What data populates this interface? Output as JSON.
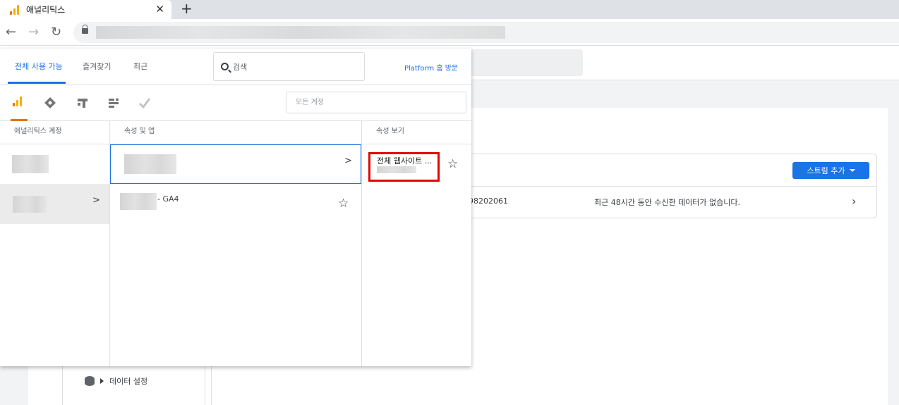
{
  "browser": {
    "tab_title": "애널리틱스",
    "tab_close": "✕",
    "new_tab": "+",
    "back": "←",
    "forward": "→",
    "reload": "↻"
  },
  "picker": {
    "tabs": [
      {
        "label": "전체 사용 가능",
        "active": true
      },
      {
        "label": "즐겨찾기",
        "active": false
      },
      {
        "label": "최근",
        "active": false
      }
    ],
    "search_label": "검색",
    "platform_link": "Platform 홈 방문",
    "account_filter_placeholder": "모든 계정",
    "products": [
      "analytics-icon",
      "tag-manager-icon",
      "optimize-icon",
      "data-studio-icon",
      "surveys-icon"
    ],
    "columns": {
      "accounts_header": "애널리틱스 계정",
      "properties_header": "속성 및 앱",
      "views_header": "속성 보기"
    },
    "properties": [
      {
        "suffix": "- GA4"
      }
    ],
    "views": [
      {
        "name": "전체 웹사이트 ..."
      }
    ]
  },
  "background": {
    "add_stream_label": "스트림 추가",
    "stream_id": "98202061",
    "stream_status": "최근 48시간 동안 수신한 데이터가 없습니다.",
    "data_settings_label": "데이터 설정"
  },
  "colors": {
    "accent": "#1a73e8",
    "highlight": "#e10600",
    "analytics_orange": "#f9ab00"
  }
}
